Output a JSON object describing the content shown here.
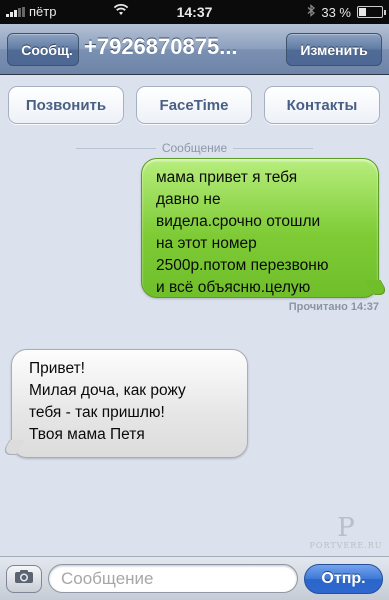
{
  "status_bar": {
    "carrier": "пётр",
    "time": "14:37",
    "battery_text": "33 %",
    "battery_level_percent": 33,
    "icons": [
      "signal-icon",
      "wifi-icon",
      "bluetooth-icon",
      "battery-icon"
    ]
  },
  "nav": {
    "back_label": "Сообщ.",
    "title": "+7926870875...",
    "edit_label": "Изменить"
  },
  "actions": {
    "call_label": "Позвонить",
    "facetime_label": "FaceTime",
    "contacts_label": "Контакты"
  },
  "conversation": {
    "divider_label": "Сообщение",
    "sent": {
      "lines": [
        "мама привет я тебя",
        "давно не",
        "видела.срочно отошли",
        "на этот номер",
        "2500р.потом перезвоню",
        "и всё объясню.целую"
      ],
      "status": "Прочитано 14:37"
    },
    "received": {
      "lines": [
        "Привет!",
        "Милая доча, как рожу",
        "тебя - так пришлю!",
        "Твоя мама Петя"
      ]
    }
  },
  "watermark": {
    "letter": "P",
    "text": "PORTVERE.RU"
  },
  "input_bar": {
    "placeholder": "Сообщение",
    "value": "",
    "send_label": "Отпр."
  },
  "colors": {
    "sent_bubble": "#7ecb36",
    "received_bubble": "#e6e6e6",
    "nav_bar": "#7b91b3",
    "send_button": "#3d78d8"
  }
}
